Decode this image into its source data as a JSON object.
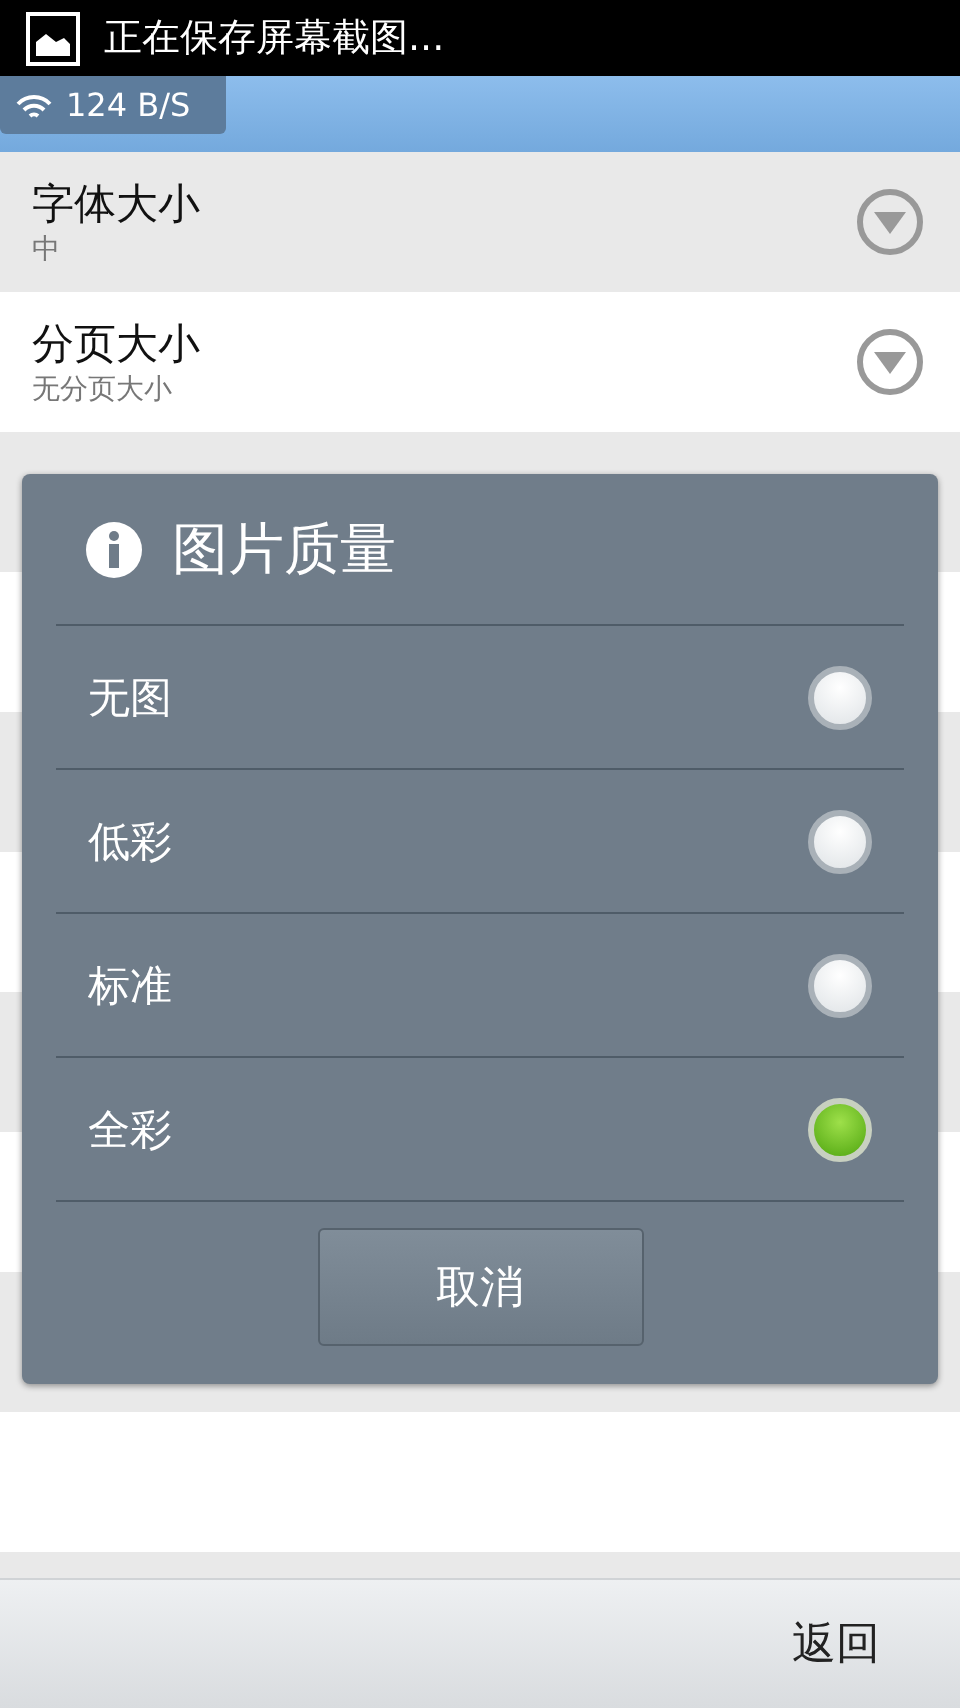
{
  "status_bar": {
    "notification": "正在保存屏幕截图..."
  },
  "speed_chip": {
    "text": "124 B/S"
  },
  "settings": [
    {
      "kind": "dropdown",
      "title": "字体大小",
      "summary": "中"
    },
    {
      "kind": "dropdown",
      "title": "分页大小",
      "summary": "无分页大小"
    }
  ],
  "dialog": {
    "title": "图片质量",
    "options": [
      {
        "label": "无图",
        "selected": false
      },
      {
        "label": "低彩",
        "selected": false
      },
      {
        "label": "标准",
        "selected": false
      },
      {
        "label": "全彩",
        "selected": true
      }
    ],
    "cancel": "取消"
  },
  "footer": {
    "back": "返回"
  }
}
